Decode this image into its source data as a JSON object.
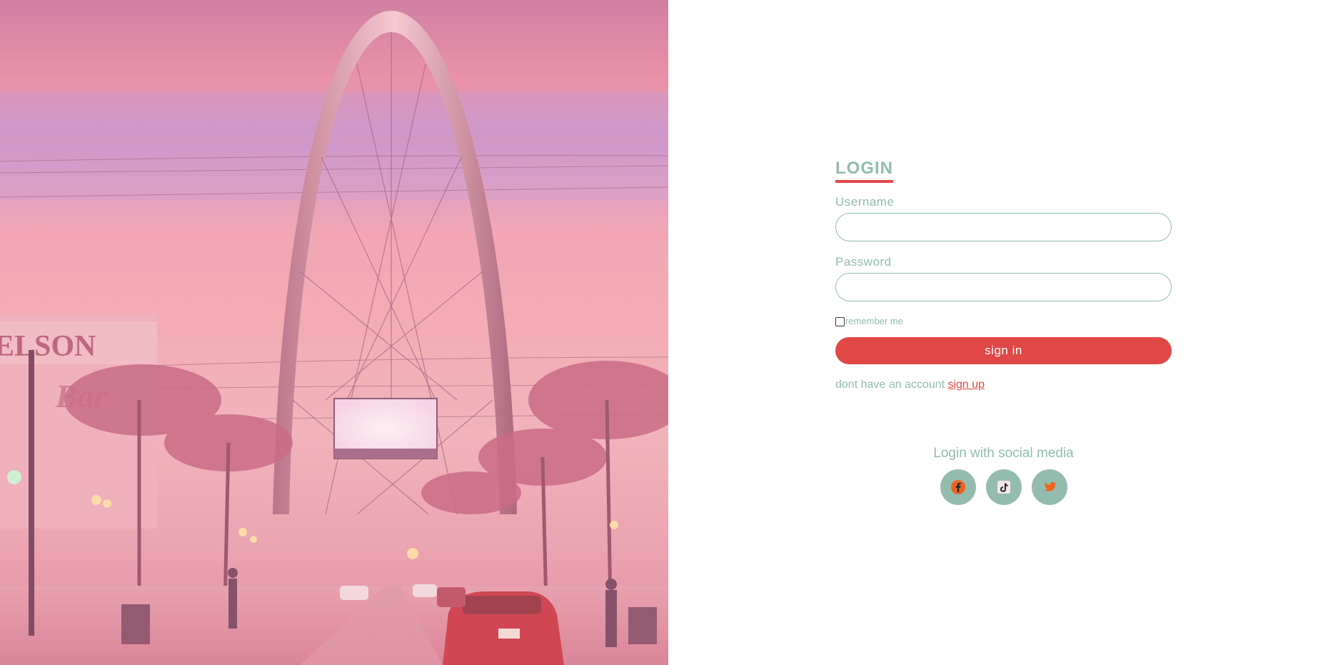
{
  "hero": {
    "description_icon": "city-arch-photo",
    "sign_text": "ELSON",
    "sign_script": "Bar"
  },
  "login": {
    "title": "LOGIN",
    "username_label": "Username",
    "username_value": "",
    "password_label": "Password",
    "password_value": "",
    "remember_label": "remember me",
    "remember_checked": false,
    "signin_label": "sign in",
    "no_account_text": "dont have an account",
    "signup_link": "sign up"
  },
  "social": {
    "title": "Login with social media",
    "icons": [
      "facebook-icon",
      "tiktok-icon",
      "twitter-icon"
    ]
  },
  "colors": {
    "accent": "#e04848",
    "muted": "#8fbcac",
    "icon_bg": "#93bcaf",
    "icon_fg": "#f0621a"
  }
}
